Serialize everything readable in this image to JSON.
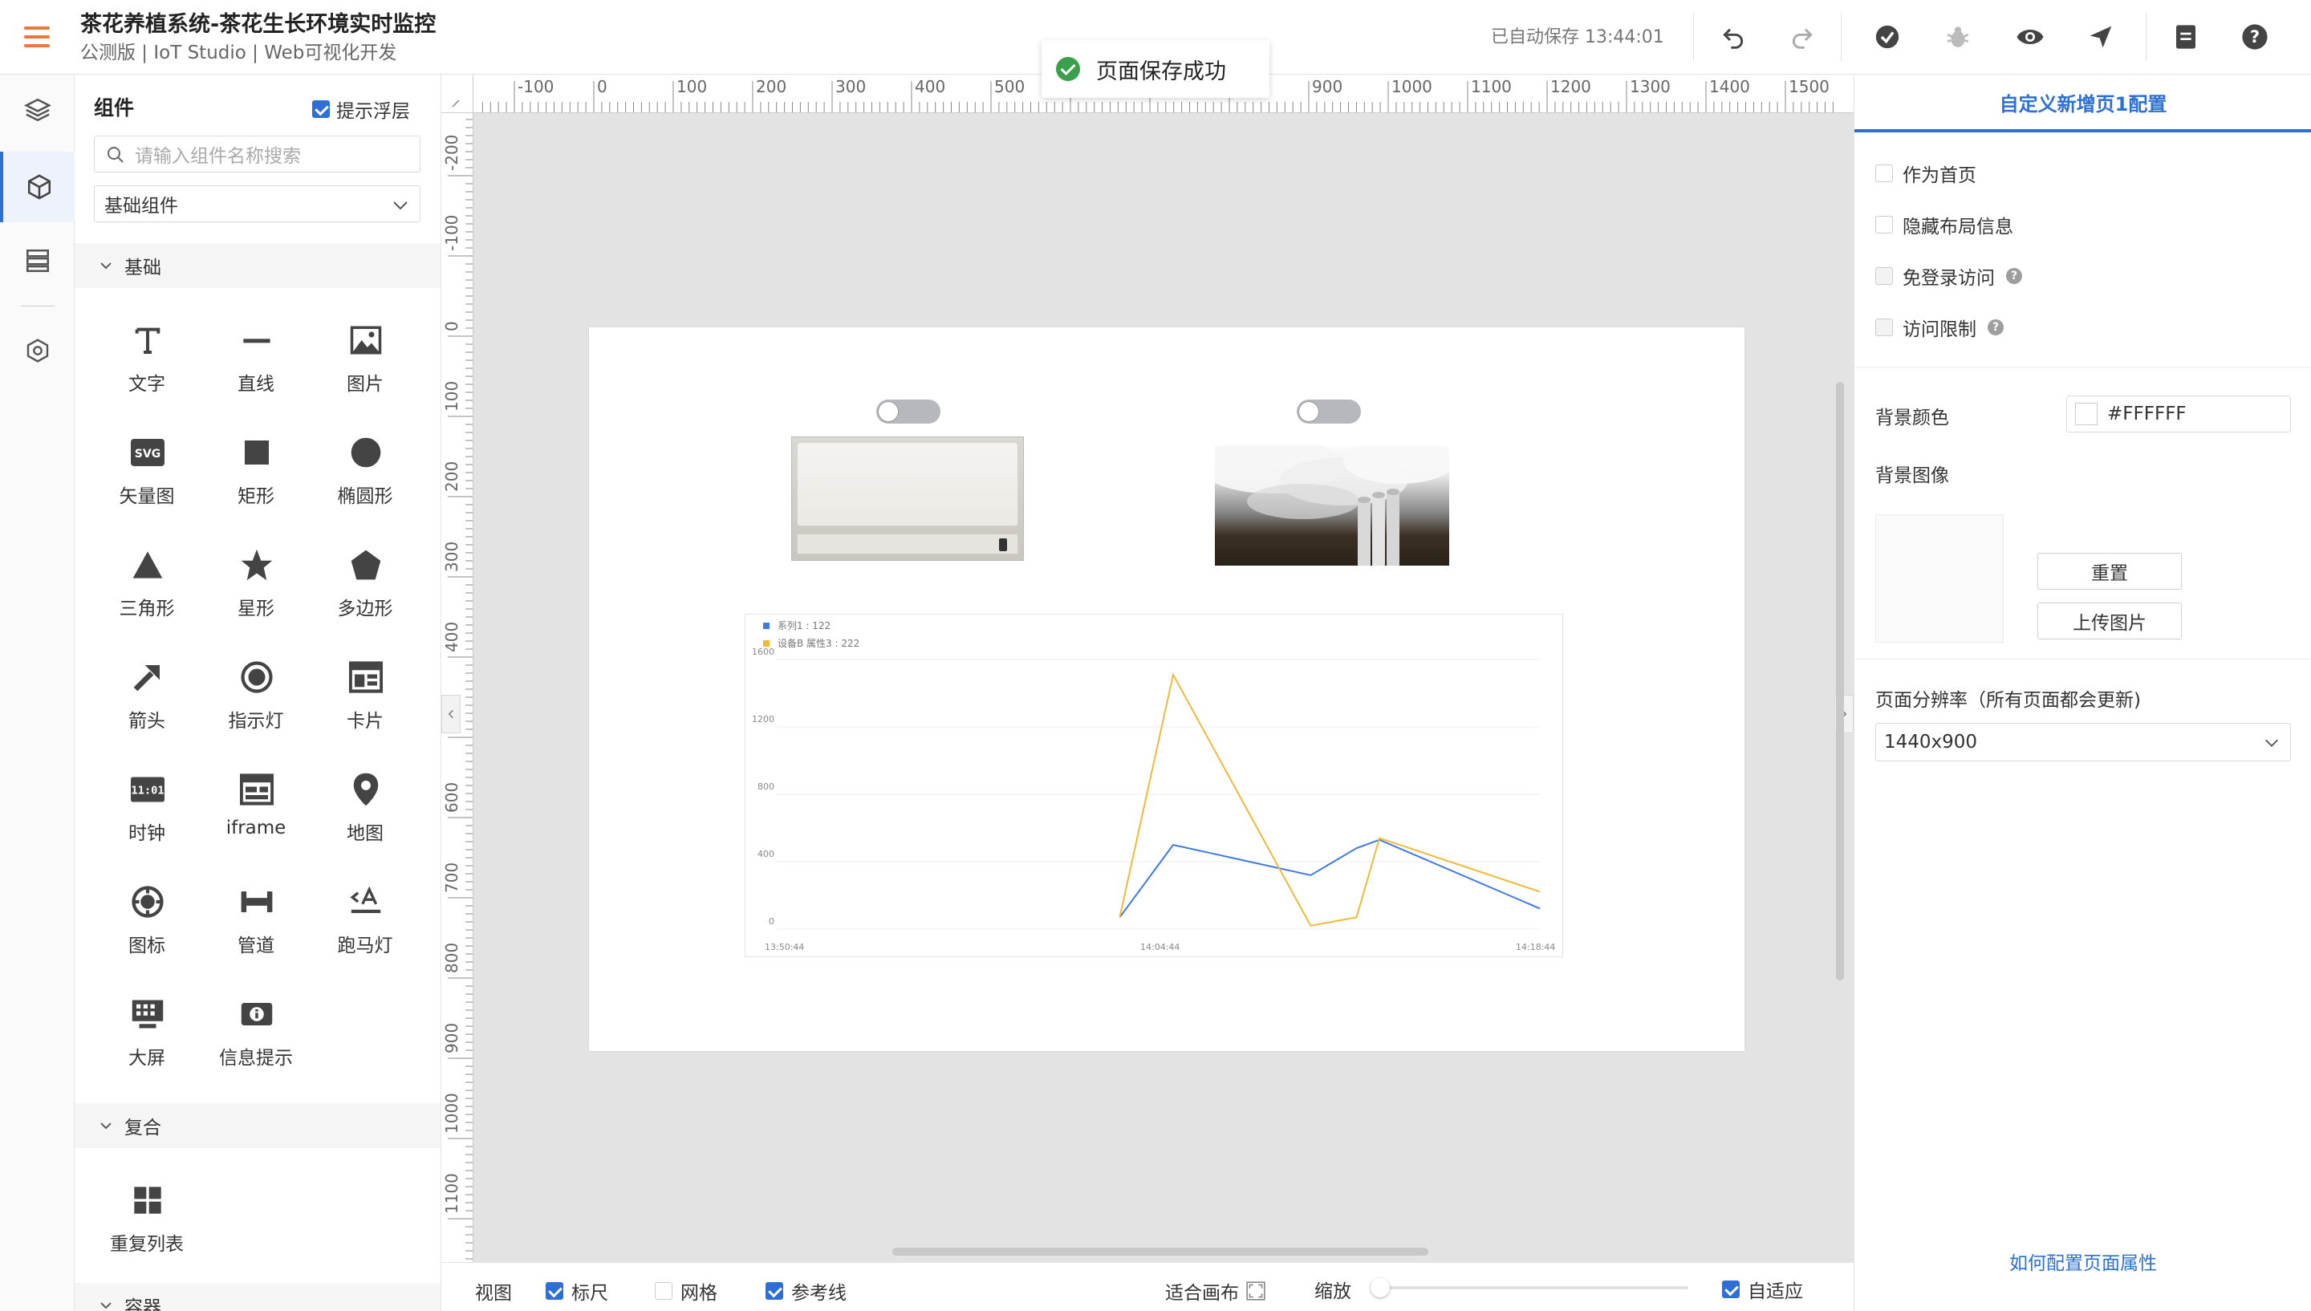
{
  "header": {
    "title": "茶花养植系统-茶花生长环境实时监控",
    "subtitle": "公测版 | IoT Studio | Web可视化开发",
    "autosave": "已自动保存 13:44:01",
    "icons": [
      "undo-icon",
      "redo-icon",
      "check-circle-icon",
      "bug-icon",
      "eye-icon",
      "send-icon",
      "document-icon",
      "help-icon"
    ]
  },
  "toast": {
    "text": "页面保存成功"
  },
  "left_nav": {
    "icons": [
      "layers-icon",
      "cube-icon",
      "list-icon",
      "settings-hex-icon"
    ],
    "active_index": 1
  },
  "component_panel": {
    "title": "组件",
    "tip_layer_label": "提示浮层",
    "tip_layer_checked": true,
    "search_placeholder": "请输入组件名称搜索",
    "category": "基础组件",
    "sections": [
      {
        "name": "基础",
        "items": [
          "文字",
          "直线",
          "图片",
          "矢量图",
          "矩形",
          "椭圆形",
          "三角形",
          "星形",
          "多边形",
          "箭头",
          "指示灯",
          "卡片",
          "时钟",
          "iframe",
          "地图",
          "图标",
          "管道",
          "跑马灯",
          "大屏",
          "信息提示"
        ]
      },
      {
        "name": "复合",
        "items": [
          "重复列表"
        ]
      },
      {
        "name": "容器",
        "items": []
      }
    ]
  },
  "rulers": {
    "top_labels": [
      "-100",
      "0",
      "100",
      "200",
      "300",
      "400",
      "500",
      "900",
      "1000",
      "1100",
      "1200",
      "1300",
      "1400",
      "1500"
    ],
    "left_labels": [
      "-200",
      "-100",
      "0",
      "100",
      "200",
      "300",
      "400",
      "500",
      "600",
      "700",
      "800",
      "900",
      "1000",
      "1100"
    ]
  },
  "canvas": {
    "toggles": [
      {
        "on": false
      },
      {
        "on": false
      }
    ],
    "images": [
      "air-conditioner-image",
      "humidifier-smoke-image"
    ]
  },
  "chart_data": {
    "type": "line",
    "legend": [
      {
        "name": "系列1 : 122",
        "color": "#3f7be0"
      },
      {
        "name": "设备B 属性3 : 222",
        "color": "#f0b93a"
      }
    ],
    "x_ticks": [
      "13:50:44",
      "14:04:44",
      "14:18:44"
    ],
    "y_ticks": [
      "0",
      "400",
      "800",
      "1200",
      "1600"
    ],
    "ylim": [
      0,
      1600
    ],
    "xlim": [
      0,
      1
    ],
    "series": [
      {
        "name": "系列1 : 122",
        "color": "#3f7be0",
        "points": [
          [
            0.45,
            70
          ],
          [
            0.52,
            500
          ],
          [
            0.7,
            320
          ],
          [
            0.76,
            480
          ],
          [
            0.79,
            530
          ],
          [
            1.0,
            122
          ]
        ]
      },
      {
        "name": "设备B 属性3 : 222",
        "color": "#f0b93a",
        "points": [
          [
            0.45,
            70
          ],
          [
            0.52,
            1510
          ],
          [
            0.7,
            20
          ],
          [
            0.76,
            70
          ],
          [
            0.79,
            540
          ],
          [
            1.0,
            222
          ]
        ]
      }
    ]
  },
  "bottom_bar": {
    "view_label": "视图",
    "ruler_label": "标尺",
    "ruler_checked": true,
    "grid_label": "网格",
    "grid_checked": false,
    "guide_label": "参考线",
    "guide_checked": true,
    "fit_label": "适合画布",
    "zoom_label": "缩放",
    "auto_label": "自适应",
    "auto_checked": true
  },
  "right_panel": {
    "title": "自定义新增页1配置",
    "options": [
      {
        "label": "作为首页",
        "checked": false,
        "help": false
      },
      {
        "label": "隐藏布局信息",
        "checked": false,
        "help": false
      },
      {
        "label": "免登录访问",
        "checked": false,
        "help": true
      },
      {
        "label": "访问限制",
        "checked": false,
        "help": true
      }
    ],
    "bg_color_label": "背景颜色",
    "bg_color_value": "#FFFFFF",
    "bg_image_label": "背景图像",
    "reset_button": "重置",
    "upload_button": "上传图片",
    "resolution_label": "页面分辨率（所有页面都会更新)",
    "resolution_value": "1440x900",
    "help_link": "如何配置页面属性"
  },
  "colors": {
    "accent": "#2d6fd6",
    "menu": "#e8793a",
    "success": "#3aa04b"
  }
}
